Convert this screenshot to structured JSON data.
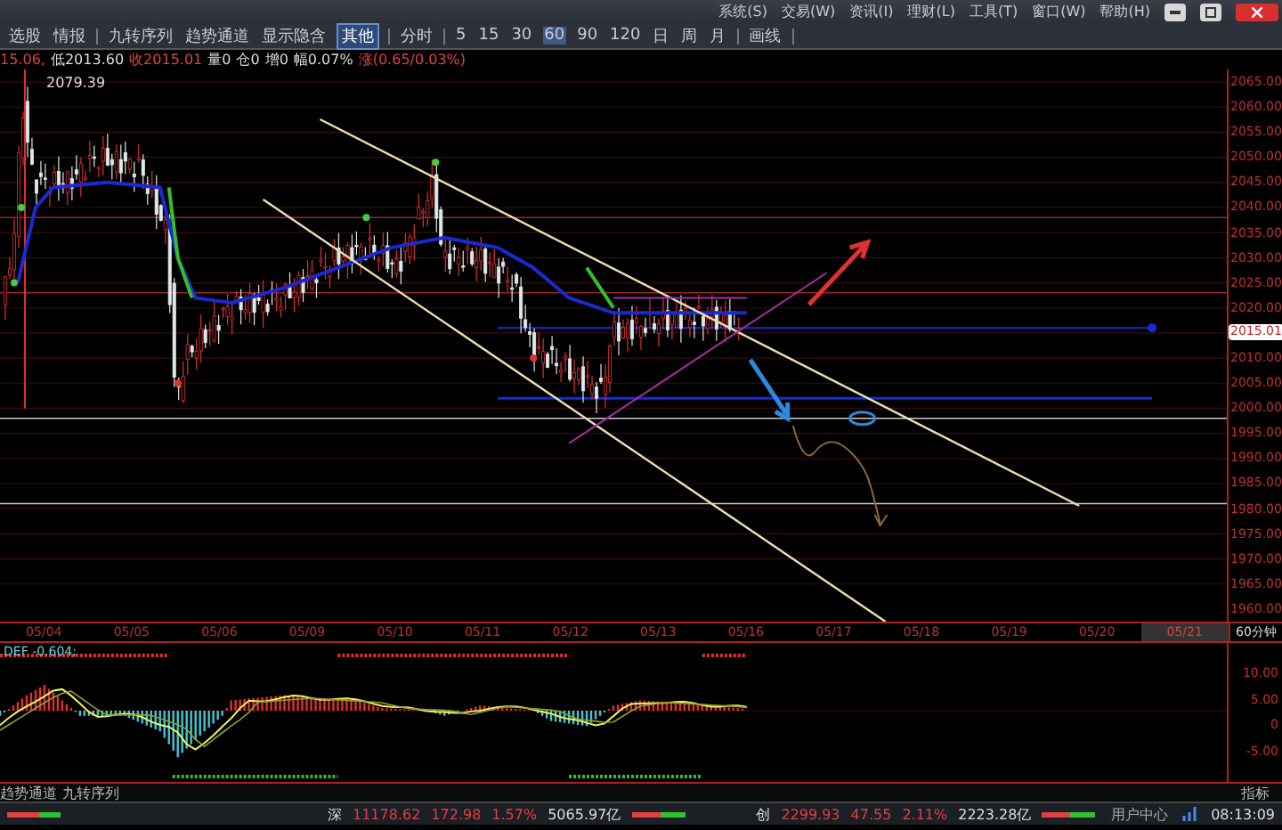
{
  "menu": [
    "系统(S)",
    "交易(W)",
    "资讯(I)",
    "理财(L)",
    "工具(T)",
    "窗口(W)",
    "帮助(H)"
  ],
  "toolbar": {
    "tools": [
      "选股",
      "情报"
    ],
    "indicators": [
      "九转序列",
      "趋势通道",
      "显示隐含"
    ],
    "dropdown": "其他",
    "intraday": "分时",
    "periods": [
      {
        "label": "5",
        "selected": false
      },
      {
        "label": "15",
        "selected": false
      },
      {
        "label": "30",
        "selected": false
      },
      {
        "label": "60",
        "selected": true
      },
      {
        "label": "90",
        "selected": false
      },
      {
        "label": "120",
        "selected": false
      },
      {
        "label": "日",
        "selected": false
      },
      {
        "label": "周",
        "selected": false
      },
      {
        "label": "月",
        "selected": false
      }
    ],
    "draw": "画线"
  },
  "info_line": [
    {
      "text": "15.06,",
      "kind": "up"
    },
    {
      "text": "低2013.60",
      "kind": "neutral"
    },
    {
      "text": "收2015.01",
      "kind": "up"
    },
    {
      "text": "量0",
      "kind": "neutral"
    },
    {
      "text": "仓0",
      "kind": "neutral"
    },
    {
      "text": "增0",
      "kind": "neutral"
    },
    {
      "text": "幅0.07%",
      "kind": "neutral"
    },
    {
      "text": "涨(0.65/0.03%)",
      "kind": "up"
    }
  ],
  "main_chart": {
    "high_label": "2079.39",
    "price_tag": "2015.01",
    "price_axis": [
      "2065.00",
      "2060.00",
      "2055.00",
      "2050.00",
      "2045.00",
      "2040.00",
      "2035.00",
      "2030.00",
      "2025.00",
      "2020.00",
      "2010.00",
      "2005.00",
      "2000.00",
      "1995.00",
      "1990.00",
      "1985.00",
      "1980.00",
      "1975.00",
      "1970.00",
      "1965.00",
      "1960.00"
    ]
  },
  "dates": [
    {
      "label": "05/04",
      "selected": false
    },
    {
      "label": "05/05",
      "selected": false
    },
    {
      "label": "05/06",
      "selected": false
    },
    {
      "label": "05/09",
      "selected": false
    },
    {
      "label": "05/10",
      "selected": false
    },
    {
      "label": "05/11",
      "selected": false
    },
    {
      "label": "05/12",
      "selected": false
    },
    {
      "label": "05/13",
      "selected": false
    },
    {
      "label": "05/16",
      "selected": false
    },
    {
      "label": "05/17",
      "selected": false
    },
    {
      "label": "05/18",
      "selected": false
    },
    {
      "label": "05/19",
      "selected": false
    },
    {
      "label": "05/20",
      "selected": false
    },
    {
      "label": "05/21",
      "selected": true
    }
  ],
  "period_label": "60分钟",
  "indicator": {
    "header": "DEF -0.604;",
    "axis": [
      "10.00",
      "5.00",
      "0",
      "-5.00"
    ]
  },
  "bottom_tabs": [
    {
      "label": "趋势通道",
      "selected": false
    },
    {
      "label": "九转序列",
      "selected": false
    }
  ],
  "bottom_right": "指标",
  "status_bar": {
    "indices": [
      {
        "name": "深",
        "value": "11178.62",
        "change": "172.98",
        "pct": "1.57%",
        "amount": "5065.97亿"
      },
      {
        "name": "创",
        "value": "2299.93",
        "change": "47.55",
        "pct": "2.11%",
        "amount": "2223.28亿"
      }
    ],
    "user_center": "用户中心",
    "time": "08:13:09"
  }
}
